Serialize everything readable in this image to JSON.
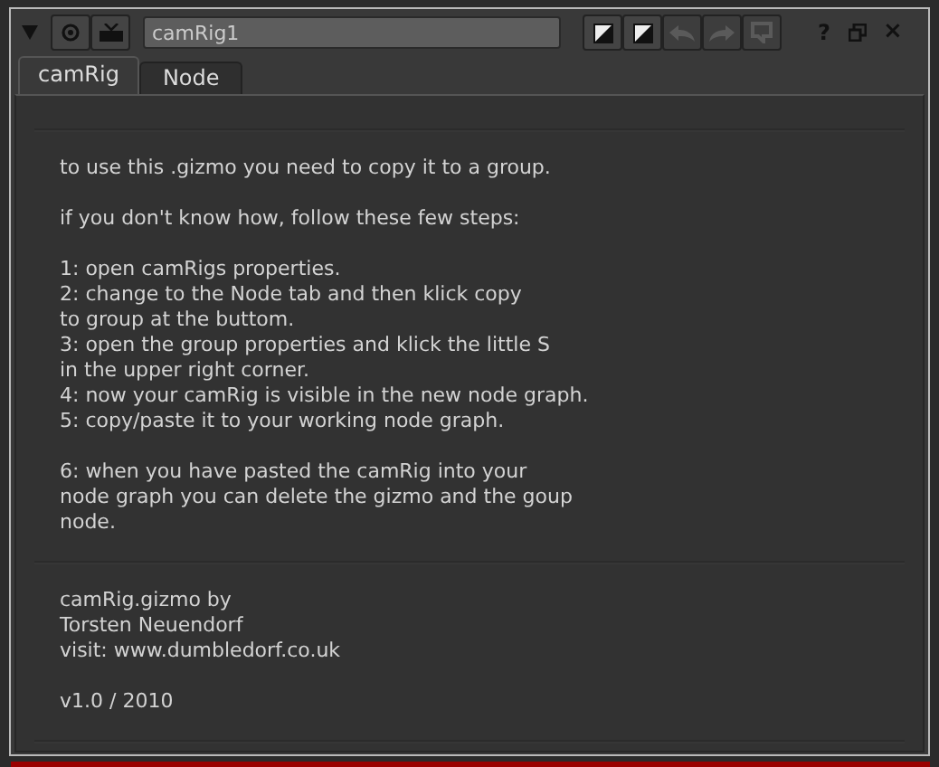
{
  "toolbar": {
    "name_value": "camRig1",
    "buttons": [
      {
        "kind": "split",
        "disabled": false
      },
      {
        "kind": "split",
        "disabled": false
      },
      {
        "kind": "undo",
        "disabled": true
      },
      {
        "kind": "redo",
        "disabled": true
      },
      {
        "kind": "revert",
        "disabled": true
      }
    ],
    "help": "?",
    "close": "×"
  },
  "tabs": [
    {
      "label": "camRig",
      "selected": true
    },
    {
      "label": "Node",
      "selected": false
    }
  ],
  "sections": [
    {
      "paragraphs": [
        [
          "to use this .gizmo you need to copy it to a group."
        ],
        [
          "if you don't know how, follow these few steps:"
        ],
        [
          "1: open camRigs properties.",
          "2: change to the Node tab and then klick copy",
          "to group at the buttom.",
          "3: open the group properties and klick the little S",
          "in the upper right corner.",
          "4: now your camRig is visible in the new node graph.",
          "5: copy/paste it to your working node graph."
        ],
        [
          "6: when you have pasted the camRig into your",
          "node graph you can delete the gizmo and the goup",
          "node."
        ]
      ]
    },
    {
      "paragraphs": [
        [
          "camRig.gizmo by",
          "Torsten Neuendorf",
          "visit: www.dumbledorf.co.uk"
        ],
        [
          "v1.0 / 2010"
        ]
      ]
    }
  ]
}
